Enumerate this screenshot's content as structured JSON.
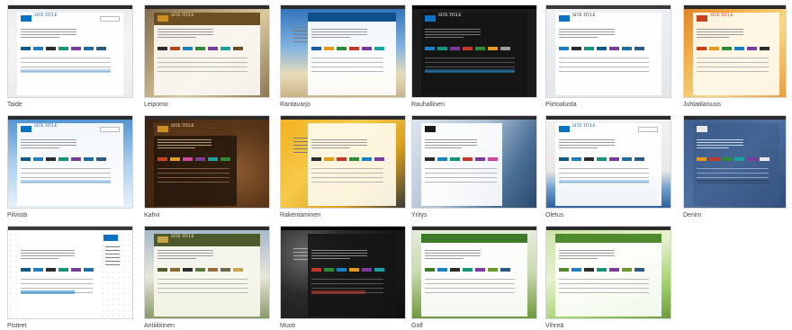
{
  "gallery": {
    "themes": [
      {
        "name": "Taide"
      },
      {
        "name": "Leipomo"
      },
      {
        "name": "Rantavarjo"
      },
      {
        "name": "Rauhallinen"
      },
      {
        "name": "Piirtoalusta"
      },
      {
        "name": "Juhlatilaisuus"
      },
      {
        "name": "Pilvistä"
      },
      {
        "name": "Kahvi"
      },
      {
        "name": "Rakentaminen"
      },
      {
        "name": "Yritys"
      },
      {
        "name": "Oletus"
      },
      {
        "name": "Denim"
      },
      {
        "name": "Pisteet"
      },
      {
        "name": "Antiikkinen"
      },
      {
        "name": "Muoti"
      },
      {
        "name": "Golf"
      },
      {
        "name": "Vihreä"
      }
    ]
  },
  "thumbnail": {
    "site_title": "SITE TITLE"
  }
}
